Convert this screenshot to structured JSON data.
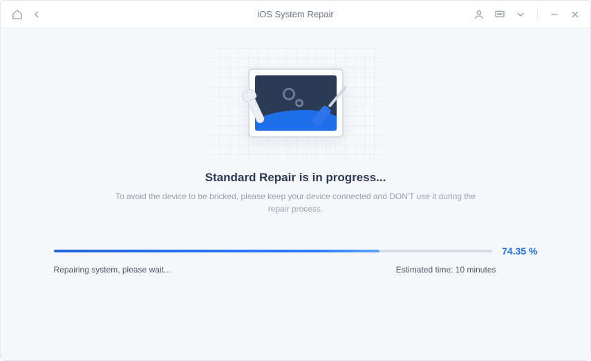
{
  "window": {
    "title": "iOS System Repair"
  },
  "main": {
    "heading": "Standard Repair is in progress...",
    "subtext": "To avoid the device to be bricked, please keep your device connected and DON'T use it during the repair process.",
    "progress": {
      "percent_value": 74.35,
      "percent_label": "74.35 %",
      "status_text": "Repairing system, please wait...",
      "estimated_time": "Estimated time: 10 minutes",
      "fill_width": "74.35%"
    }
  },
  "colors": {
    "accent": "#1f6eea",
    "heading": "#2b3a55",
    "muted": "#9aa3af"
  }
}
